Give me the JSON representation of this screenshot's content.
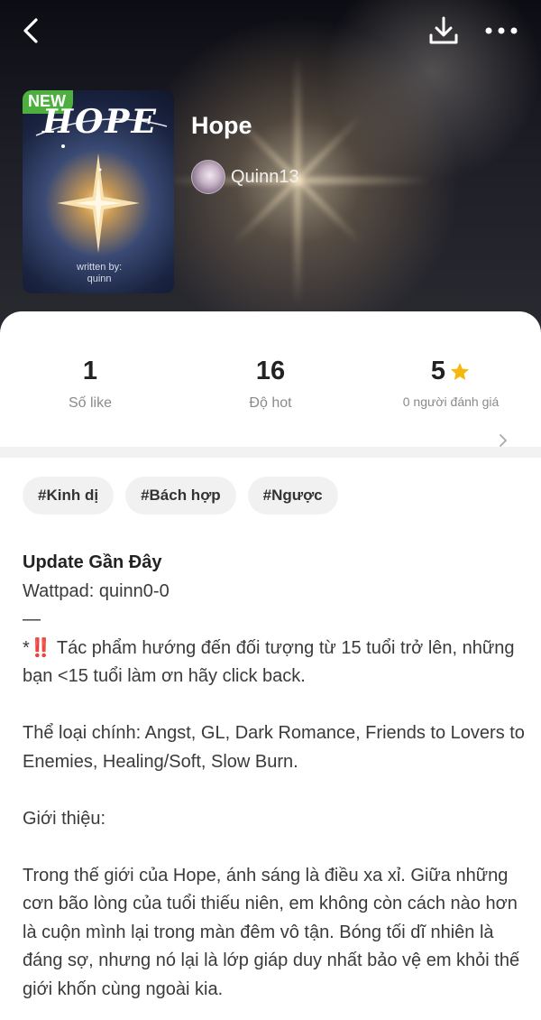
{
  "header": {
    "back_icon": "chevron-left-icon",
    "download_icon": "download-icon",
    "more_icon": "more-horizontal-icon"
  },
  "cover": {
    "badge": "NEW",
    "title_art": "HOPE",
    "byline": "written by:\nquinn"
  },
  "story": {
    "title": "Hope",
    "author": "Quinn13"
  },
  "stats": {
    "likes": {
      "value": "1",
      "label": "Số like"
    },
    "hot": {
      "value": "16",
      "label": "Độ hot"
    },
    "rating": {
      "value": "5",
      "label": "0 người đánh giá",
      "star_color": "#f6b70e"
    }
  },
  "tags": [
    "#Kinh dị",
    "#Bách hợp",
    "#Ngược"
  ],
  "description": {
    "heading": "Update Gần Đây",
    "lines": {
      "wattpad": "Wattpad: quinn0-0",
      "dash": "—",
      "warning_prefix": "*",
      "warning_mark": "‼️",
      "warning_text": " Tác phẩm hướng đến đối tượng từ 15 tuổi trở lên, những bạn <15 tuổi làm ơn hãy click back.",
      "genres": "Thể loại chính: Angst, GL, Dark Romance, Friends to Lovers to Enemies, Healing/Soft, Slow Burn.",
      "intro_label": "Giới thiệu:",
      "intro_text": "Trong thế giới của Hope, ánh sáng là điều xa xỉ. Giữa những cơn bão lòng của tuổi thiếu niên, em không còn cách nào hơn là cuộn mình lại trong màn đêm vô tận. Bóng tối dĩ nhiên là đáng sợ, nhưng nó lại là lớp giáp duy nhất bảo vệ em khỏi thế giới khốn cùng ngoài kia."
    }
  },
  "colors": {
    "badge_green": "#4caf3e",
    "warning_red": "#e0242f",
    "star_yellow": "#f6b70e"
  }
}
